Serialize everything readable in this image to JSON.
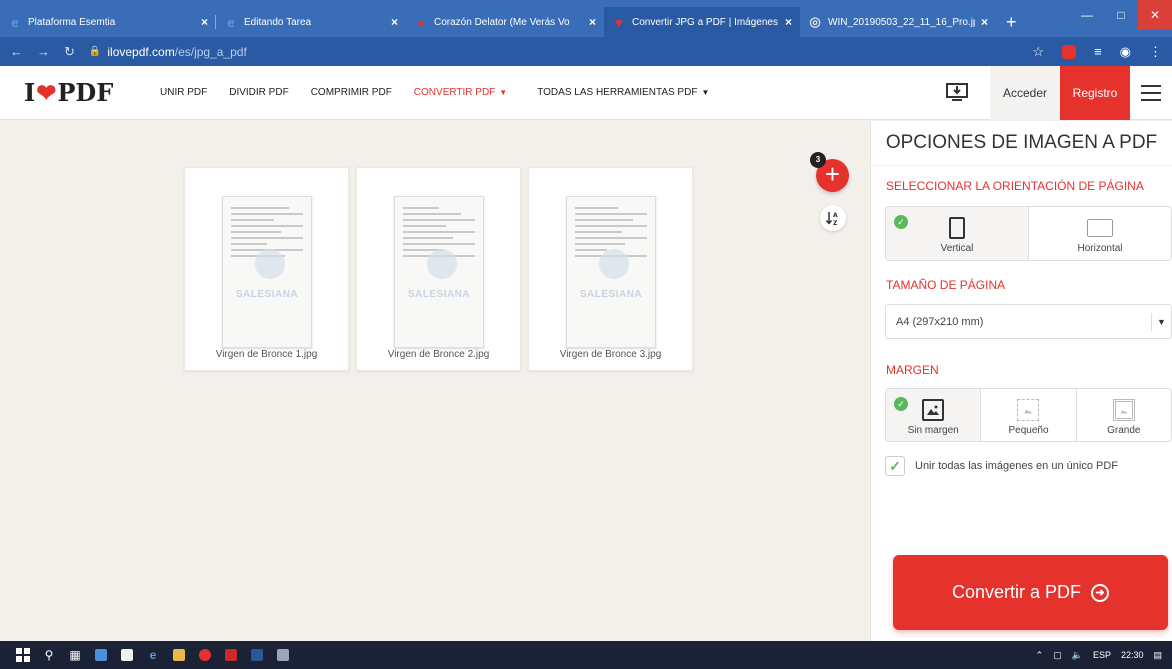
{
  "browser": {
    "tabs": [
      {
        "title": "Plataforma Esemtia",
        "close": "×",
        "fav": "e",
        "fav_color": "#5b9bd5"
      },
      {
        "title": "Editando Tarea",
        "close": "×",
        "fav": "e",
        "fav_color": "#5b9bd5"
      },
      {
        "title": "Corazón Delator (Me Verás Vo",
        "close": "×",
        "fav": "●",
        "fav_color": "#e5322d"
      },
      {
        "title": "Convertir JPG a PDF | Imágenes",
        "close": "×",
        "fav": "♥",
        "fav_color": "#e5322d"
      },
      {
        "title": "WIN_20190503_22_11_16_Pro.jp",
        "close": "×",
        "fav": "◎",
        "fav_color": "#dddddd"
      }
    ],
    "new_tab": "+",
    "url_host": "ilovepdf.com",
    "url_path": "/es/jpg_a_pdf"
  },
  "header": {
    "logo_left": "I",
    "logo_right": "PDF",
    "nav": {
      "unir": "UNIR PDF",
      "dividir": "DIVIDIR PDF",
      "comprimir": "COMPRIMIR PDF",
      "convertir": "CONVERTIR PDF",
      "todas": "TODAS LAS HERRAMIENTAS PDF"
    },
    "acceder": "Acceder",
    "registro": "Registro"
  },
  "files": [
    {
      "name": "Virgen de Bronce 1.jpg",
      "watermark": "SALESIANA"
    },
    {
      "name": "Virgen de Bronce 2.jpg",
      "watermark": "SALESIANA"
    },
    {
      "name": "Virgen de Bronce 3.jpg",
      "watermark": "SALESIANA"
    }
  ],
  "file_count": "3",
  "add_symbol": "+",
  "sort_symbol": "↓Ä̧",
  "sidebar": {
    "title": "OPCIONES DE IMAGEN A PDF",
    "orientation_label": "SELECCIONAR LA ORIENTACIÓN DE PÁGINA",
    "orientation": {
      "vertical": "Vertical",
      "horizontal": "Horizontal",
      "selected": "vertical"
    },
    "page_size_label": "TAMAÑO DE PÁGINA",
    "page_size_value": "A4 (297x210 mm)",
    "margin_label": "MARGEN",
    "margin": {
      "none": "Sin margen",
      "small": "Pequeño",
      "large": "Grande",
      "selected": "none"
    },
    "merge_label": "Unir todas las imágenes en un único PDF",
    "merge_checked": true,
    "convert_button": "Convertir a PDF"
  },
  "taskbar": {
    "lang": "ESP",
    "time": "22:30"
  },
  "colors": {
    "brand_red": "#e5322d",
    "check_green": "#5cb85c",
    "browser_blue": "#2a5aa3"
  }
}
